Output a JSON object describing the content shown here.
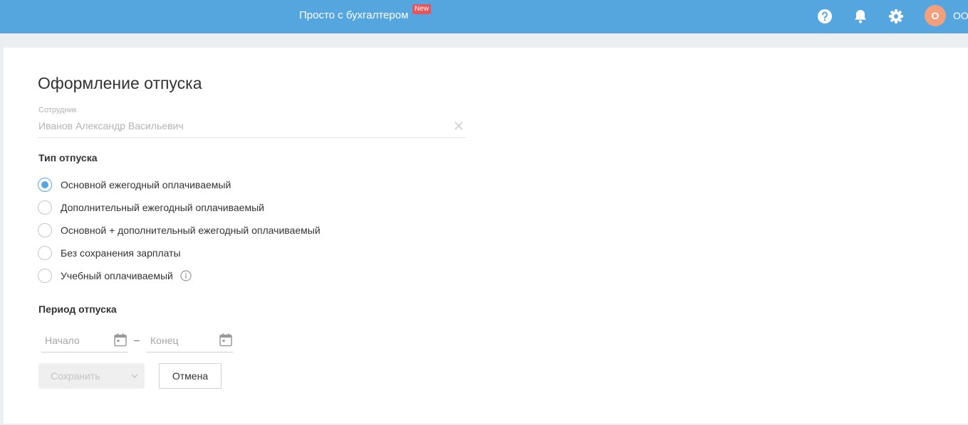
{
  "header": {
    "promo_link": "Просто с бухгалтером",
    "promo_badge": "New",
    "icons": [
      "help-icon",
      "bell-icon",
      "gear-icon"
    ],
    "avatar_initial": "О",
    "org_name": "ОО",
    "bar_color": "#55a6de",
    "badge_color": "#e8545a",
    "avatar_color": "#f2a07b"
  },
  "main": {
    "title": "Оформление отпуска",
    "employee": {
      "label": "Сотрудник",
      "value": "Иванов Александр Васильевич"
    },
    "leave_type": {
      "title": "Тип отпуска",
      "options": [
        {
          "label": "Основной ежегодный оплачиваемый",
          "checked": true
        },
        {
          "label": "Дополнительный ежегодный оплачиваемый",
          "checked": false
        },
        {
          "label": "Основной + дополнительный ежегодный оплачиваемый",
          "checked": false
        },
        {
          "label": "Без сохранения зарплаты",
          "checked": false
        },
        {
          "label": "Учебный оплачиваемый",
          "checked": false,
          "info_icon": "info-icon"
        }
      ]
    },
    "period": {
      "title": "Период отпуска",
      "start_placeholder": "Начало",
      "separator": "–",
      "end_placeholder": "Конец"
    },
    "actions": {
      "save_label": "Сохранить",
      "cancel_label": "Отмена"
    }
  }
}
